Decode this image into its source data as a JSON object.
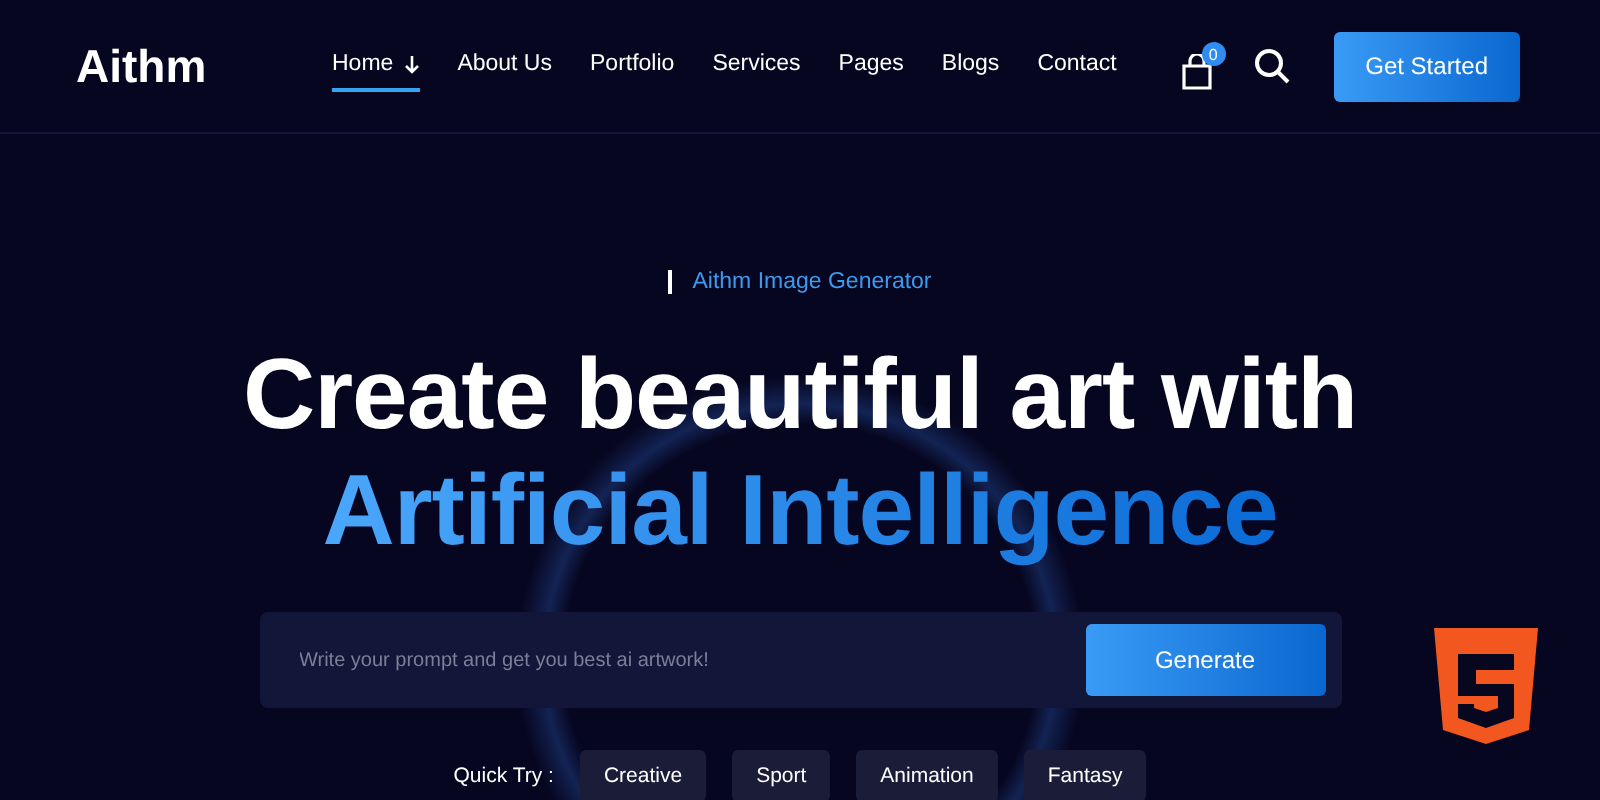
{
  "brand": "Aithm",
  "nav": [
    {
      "label": "Home",
      "selected": true,
      "dropdown": true
    },
    {
      "label": "About Us",
      "selected": false,
      "dropdown": false
    },
    {
      "label": "Portfolio",
      "selected": false,
      "dropdown": false
    },
    {
      "label": "Services",
      "selected": false,
      "dropdown": false
    },
    {
      "label": "Pages",
      "selected": false,
      "dropdown": false
    },
    {
      "label": "Blogs",
      "selected": false,
      "dropdown": false
    },
    {
      "label": "Contact",
      "selected": false,
      "dropdown": false
    }
  ],
  "cart_count": "0",
  "cta": "Get Started",
  "hero": {
    "eyebrow": "Aithm Image Generator",
    "title_line1": "Create beautiful art with",
    "title_line2": "Artificial Intelligence"
  },
  "prompt": {
    "placeholder": "Write your prompt and get you best ai artwork!",
    "button": "Generate"
  },
  "quick_try": {
    "label": "Quick Try :",
    "chips": [
      "Creative",
      "Sport",
      "Animation",
      "Fantasy"
    ]
  }
}
